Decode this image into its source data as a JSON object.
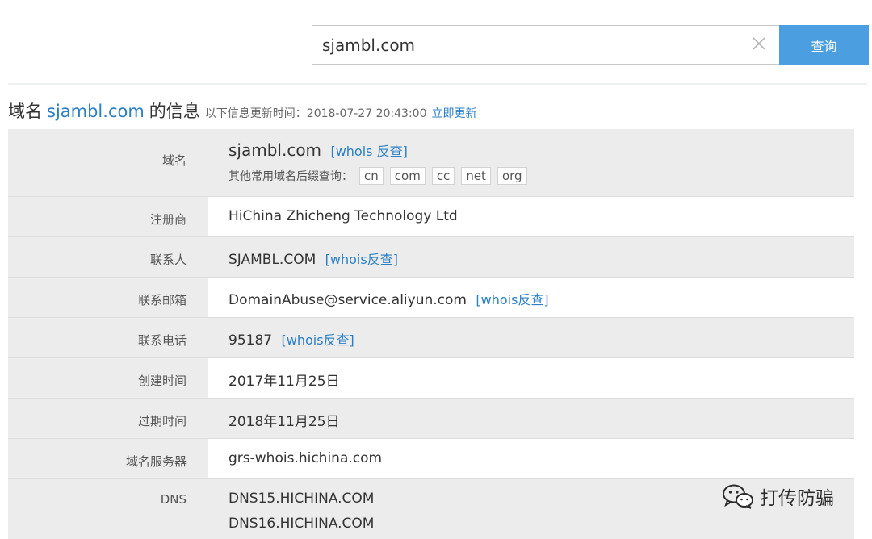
{
  "search": {
    "value": "sjambl.com",
    "button_label": "查询",
    "clear_icon": "close-icon"
  },
  "heading": {
    "prefix": "域名",
    "domain": "sjambl.com",
    "suffix": "的信息",
    "updated_text": "以下信息更新时间：2018-07-27 20:43:00",
    "update_link": "立即更新"
  },
  "rows": {
    "domain": {
      "label": "域名",
      "value": "sjambl.com",
      "link": "[whois 反查]",
      "other_suffix_label": "其他常用域名后缀查询：",
      "suffixes": [
        "cn",
        "com",
        "cc",
        "net",
        "org"
      ]
    },
    "registrar": {
      "label": "注册商",
      "value": "HiChina Zhicheng Technology Ltd"
    },
    "contact": {
      "label": "联系人",
      "value": "SJAMBL.COM",
      "link": "[whois反查]"
    },
    "email": {
      "label": "联系邮箱",
      "value": "DomainAbuse@service.aliyun.com",
      "link": "[whois反查]"
    },
    "phone": {
      "label": "联系电话",
      "value": "95187",
      "link": "[whois反查]"
    },
    "created": {
      "label": "创建时间",
      "value": "2017年11月25日"
    },
    "expires": {
      "label": "过期时间",
      "value": "2018年11月25日"
    },
    "whois_server": {
      "label": "域名服务器",
      "value": "grs-whois.hichina.com"
    },
    "dns": {
      "label": "DNS",
      "values": [
        "DNS15.HICHINA.COM",
        "DNS16.HICHINA.COM"
      ]
    }
  },
  "watermark": {
    "text": "打传防骗",
    "icon": "wechat-icon"
  },
  "colors": {
    "accent": "#4b9ee0",
    "link": "#2a7fc7",
    "row_shade": "#ececec"
  }
}
